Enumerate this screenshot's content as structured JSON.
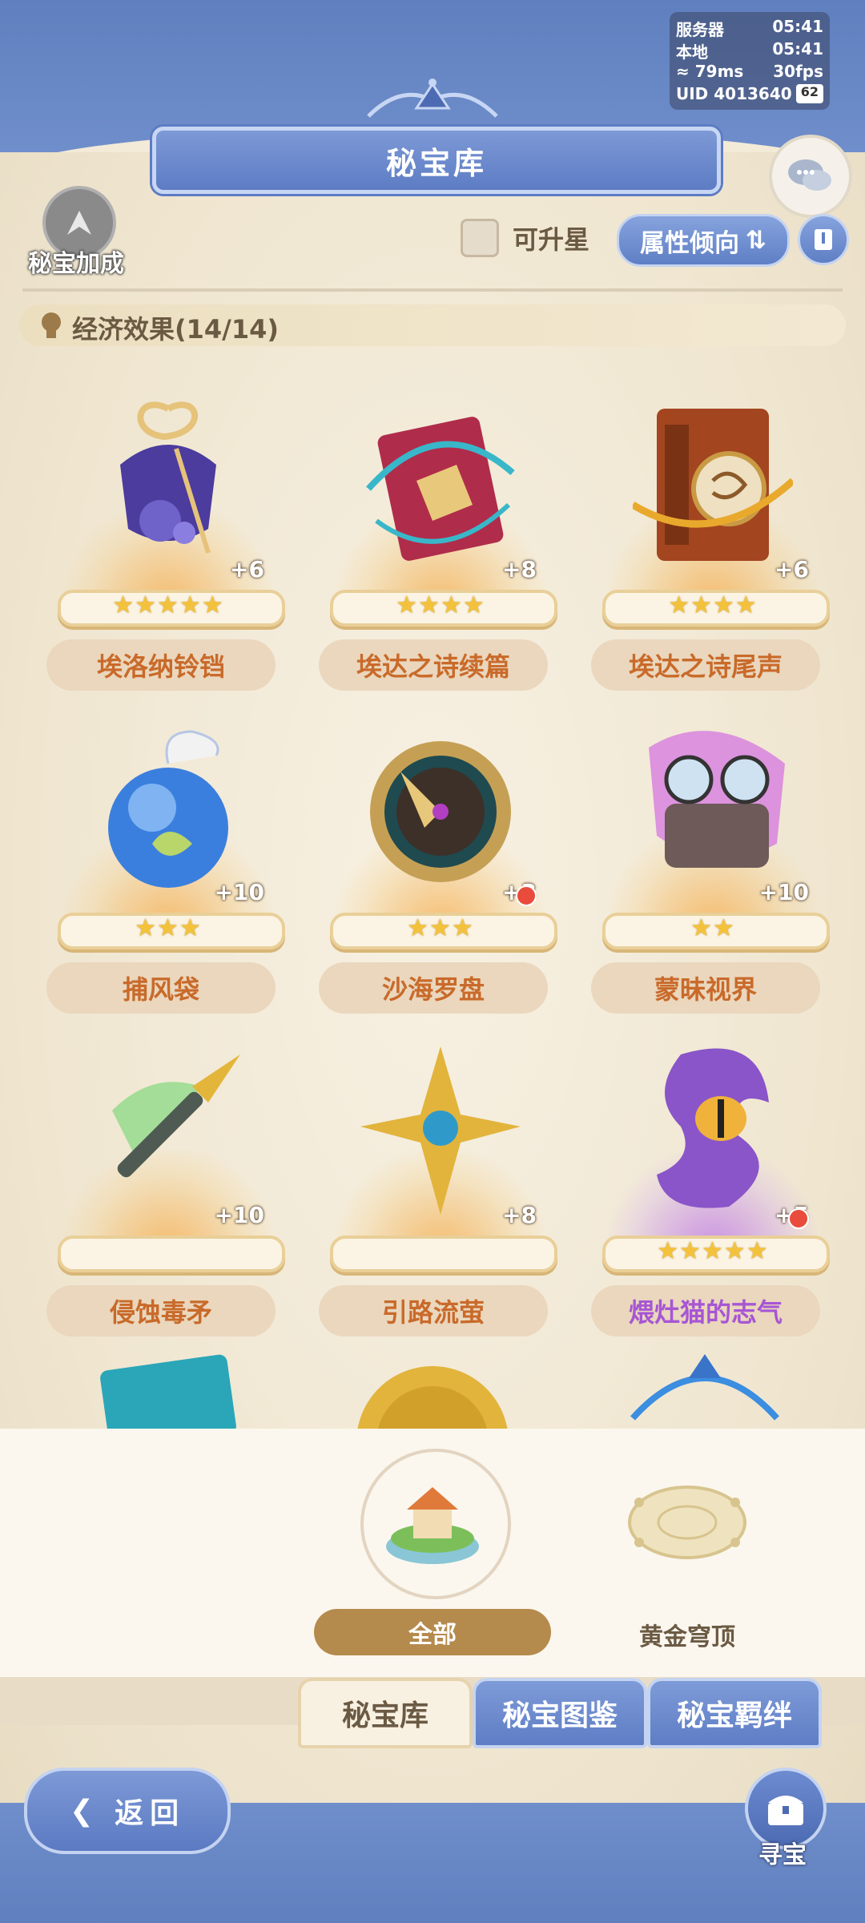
{
  "status": {
    "server_label": "服务器",
    "server_time": "05:41",
    "local_label": "本地",
    "local_time": "05:41",
    "ping": "79ms",
    "fps": "30fps",
    "uid": "UID 4013640",
    "battery": "62"
  },
  "header": {
    "title": "秘宝库"
  },
  "toolbar": {
    "bonus_label": "秘宝加成",
    "upgradable_label": "可升星",
    "attr_button": "属性倾向"
  },
  "section": {
    "title": "经济效果(14/14)"
  },
  "items": [
    {
      "name": "埃洛纳铃铛",
      "level": "+6",
      "stars": "★★★★★",
      "icon": "ribbon-bell-icon"
    },
    {
      "name": "埃达之诗续篇",
      "level": "+8",
      "stars": "★★★★",
      "icon": "red-book-icon"
    },
    {
      "name": "埃达之诗尾声",
      "level": "+6",
      "stars": "★★★★",
      "icon": "brown-book-icon"
    },
    {
      "name": "捕风袋",
      "level": "+10",
      "stars": "★★★",
      "icon": "wind-bag-icon"
    },
    {
      "name": "沙海罗盘",
      "level": "+3",
      "stars": "★★★",
      "icon": "compass-icon",
      "badge": true
    },
    {
      "name": "蒙昧视界",
      "level": "+10",
      "stars": "★★",
      "icon": "goggles-icon"
    },
    {
      "name": "侵蚀毒矛",
      "level": "+10",
      "stars": "",
      "icon": "poison-spear-icon"
    },
    {
      "name": "引路流萤",
      "level": "+8",
      "stars": "",
      "icon": "firefly-star-icon"
    },
    {
      "name": "煨灶猫的志气",
      "level": "+5",
      "stars": "★★★★★",
      "icon": "cat-eye-icon",
      "badge": true,
      "rarity": "purple"
    }
  ],
  "categories": [
    {
      "label": "全部",
      "icon": "island-house-icon"
    },
    {
      "label": "黄金穹顶",
      "icon": "golden-dome-icon"
    }
  ],
  "tabs": [
    "秘宝库",
    "秘宝图鉴",
    "秘宝羁绊"
  ],
  "footer": {
    "back_label": "返回",
    "treasure_label": "寻宝"
  }
}
